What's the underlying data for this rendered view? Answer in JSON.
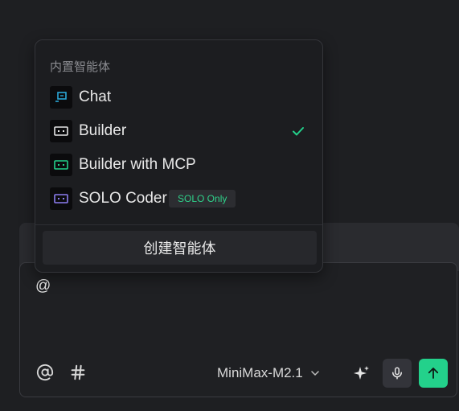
{
  "menu": {
    "header": "内置智能体",
    "items": [
      {
        "label": "Chat",
        "icon": "chat-agent-icon",
        "selected": false,
        "color": "#2aa8d8"
      },
      {
        "label": "Builder",
        "icon": "builder-agent-icon",
        "selected": true,
        "color": "#e6e6e6"
      },
      {
        "label": "Builder with MCP",
        "icon": "builder-mcp-agent-icon",
        "selected": false,
        "color": "#23d18b"
      },
      {
        "label": "SOLO Coder",
        "icon": "solo-coder-agent-icon",
        "selected": false,
        "color": "#8c7cf0",
        "badge": "SOLO Only"
      }
    ],
    "create_label": "创建智能体"
  },
  "input": {
    "text": "@",
    "model": "MiniMax-M2.1"
  },
  "colors": {
    "accent": "#23d18b",
    "background": "#1e1f22",
    "menu_bg": "#1c1d20"
  }
}
